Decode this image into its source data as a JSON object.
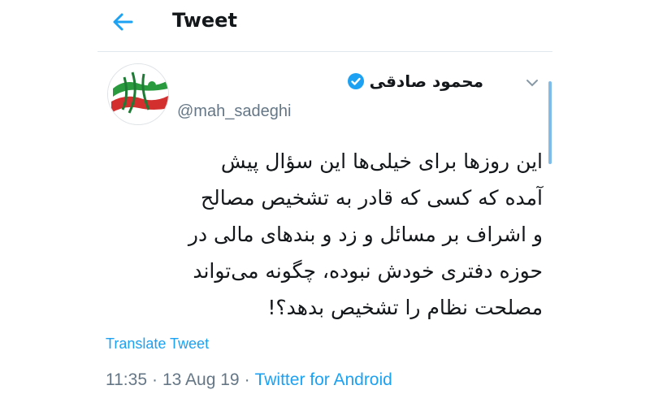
{
  "header": {
    "title": "Tweet",
    "back_icon": "arrow-left-icon"
  },
  "author": {
    "display_name": "محمود صادقی",
    "handle": "@mah_sadeghi",
    "verified": true,
    "avatar_icon": "avatar-flag-logo"
  },
  "tweet": {
    "lines": [
      "این روزها برای خیلی‌ها این سؤال پیش",
      "آمده که کسی که قادر به تشخیص مصالح",
      "و اشراف بر مسائل و زد و بندهای مالی در",
      "حوزه دفتری خودش نبوده، چگونه می‌تواند",
      "مصلحت نظام را تشخیص بدهد؟!"
    ]
  },
  "actions": {
    "translate_label": "Translate Tweet"
  },
  "meta": {
    "time": "11:35",
    "separator": "·",
    "date": "13 Aug 19",
    "source": "Twitter for Android"
  },
  "colors": {
    "accent": "#1da1f2",
    "secondary_text": "#657786",
    "primary_text": "#14171a"
  }
}
